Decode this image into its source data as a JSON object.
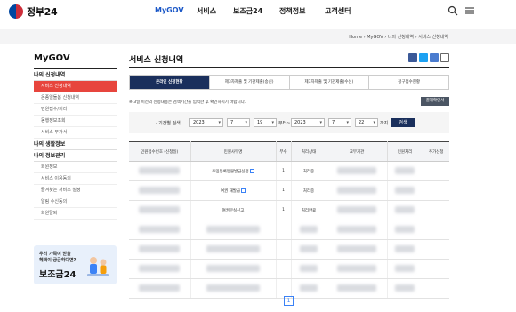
{
  "header": {
    "logo": "정부24",
    "nav": [
      "MyGOV",
      "서비스",
      "보조금24",
      "정책정보",
      "고객센터"
    ]
  },
  "breadcrumb": [
    "Home",
    "MyGOV",
    "나의 신청내역",
    "서비스 신청내역"
  ],
  "sidebar": {
    "title": "MyGOV",
    "sections": [
      {
        "label": "나의 신청내역",
        "items": [
          "서비스 신청내역",
          "온종일돌봄 신청내역",
          "민원접수/처리",
          "동행정보조회",
          "서비스 부가서"
        ]
      },
      {
        "label": "나의 생활정보",
        "items": []
      },
      {
        "label": "나의 정보관리",
        "items": [
          "회원정보",
          "서비스 이용동의",
          "즐겨찾는 서비스 설정",
          "알림 수신동의",
          "회원탈퇴"
        ]
      }
    ],
    "banner": {
      "line1": "우리 가족이 받을",
      "line2": "혜택이 궁금하다면?",
      "line3": "보조금24"
    }
  },
  "main": {
    "title": "서비스 신청내역",
    "tabs": [
      "온라인 신청현황",
      "제3자제출 및 기관제출(송신)",
      "제3자제출 및 기관제출(수신)",
      "청구접수현황"
    ],
    "notice": "※ 3일 이전의 신청내용은 검색기간을 입력한 후 확인하시기 바랍니다.",
    "print_button": "결재확인서",
    "search": {
      "label": "· 기간별 검색",
      "from_year": "2023",
      "from_month": "7",
      "from_day": "19",
      "sep_from": "부터~",
      "to_year": "2023",
      "to_month": "7",
      "to_day": "22",
      "sep_to": "까지",
      "button": "검색"
    },
    "table": {
      "headers": [
        "민원접수번호 (신청일)",
        "민원사무명",
        "부수",
        "처리상태",
        "교부기관",
        "민원처리",
        "추가신청"
      ],
      "rows": [
        {
          "name": "주민등록등본발급신청",
          "count": "1",
          "status": "처리중"
        },
        {
          "name": "여권 재발급",
          "count": "1",
          "status": "처리중"
        },
        {
          "name": "여권분실신고",
          "count": "1",
          "status": "처리완료"
        },
        {
          "name": "",
          "count": "",
          "status": ""
        },
        {
          "name": "",
          "count": "",
          "status": ""
        },
        {
          "name": "",
          "count": "",
          "status": ""
        },
        {
          "name": "",
          "count": "",
          "status": ""
        }
      ]
    },
    "page": "1"
  }
}
